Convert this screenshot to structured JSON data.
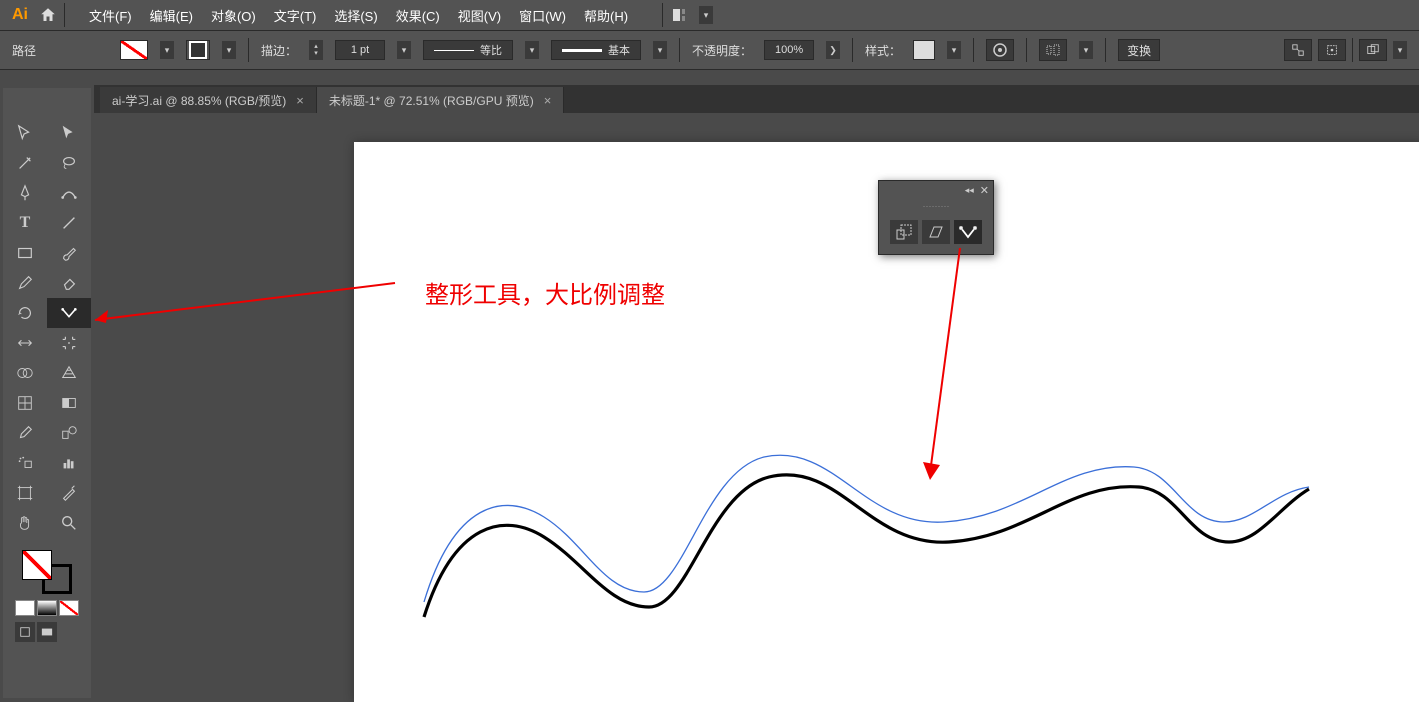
{
  "app": {
    "logo": "Ai"
  },
  "menubar": {
    "file": "文件(F)",
    "edit": "编辑(E)",
    "object": "对象(O)",
    "type": "文字(T)",
    "select": "选择(S)",
    "effect": "效果(C)",
    "view": "视图(V)",
    "window": "窗口(W)",
    "help": "帮助(H)"
  },
  "controls": {
    "path_label": "路径",
    "stroke_label": "描边：",
    "stroke_width": "1 pt",
    "uniform_label": "等比",
    "basic_label": "基本",
    "opacity_label": "不透明度：",
    "opacity_value": "100%",
    "style_label": "样式：",
    "transform_label": "变换"
  },
  "tabs": [
    {
      "label": "ai-学习.ai @ 88.85% (RGB/预览)",
      "active": false
    },
    {
      "label": "未标题-1* @ 72.51% (RGB/GPU 预览)",
      "active": true
    }
  ],
  "annotation": {
    "text": "整形工具，大比例调整"
  }
}
